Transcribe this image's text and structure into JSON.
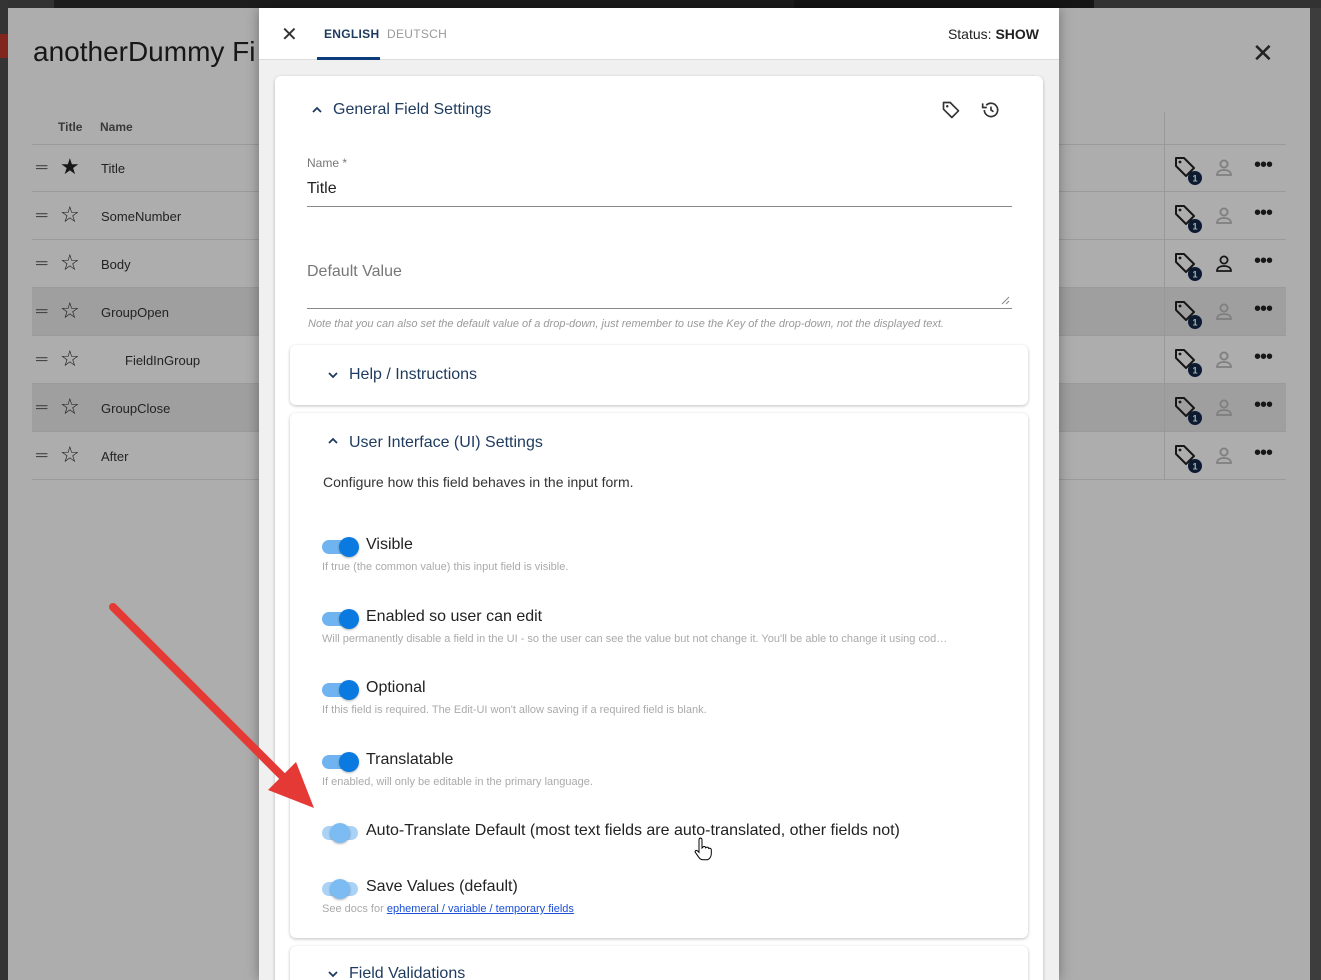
{
  "background": {
    "title": "anotherDummy Fi",
    "columns": {
      "title": "Title",
      "name": "Name"
    },
    "rows": [
      {
        "name": "Title",
        "starred": true,
        "badge": "1",
        "highlight": false,
        "indent": false,
        "person_active": false
      },
      {
        "name": "SomeNumber",
        "starred": false,
        "badge": "1",
        "highlight": false,
        "indent": false,
        "person_active": false
      },
      {
        "name": "Body",
        "starred": false,
        "badge": "1",
        "highlight": false,
        "indent": false,
        "person_active": true
      },
      {
        "name": "GroupOpen",
        "starred": false,
        "badge": "1",
        "highlight": true,
        "indent": false,
        "person_active": false
      },
      {
        "name": "FieldInGroup",
        "starred": false,
        "badge": "1",
        "highlight": false,
        "indent": true,
        "person_active": false
      },
      {
        "name": "GroupClose",
        "starred": false,
        "badge": "1",
        "highlight": true,
        "indent": false,
        "person_active": false
      },
      {
        "name": "After",
        "starred": false,
        "badge": "1",
        "highlight": false,
        "indent": false,
        "person_active": false
      }
    ]
  },
  "panel": {
    "tabs": [
      {
        "label": "ENGLISH",
        "active": true
      },
      {
        "label": "DEUTSCH",
        "active": false
      }
    ],
    "status_label": "Status:",
    "status_value": "SHOW",
    "general": {
      "title": "General Field Settings",
      "name_label": "Name *",
      "name_value": "Title",
      "default_label": "Default Value",
      "default_note": "Note that you can also set the default value of a drop-down, just remember to use the Key of the drop-down, not the displayed text."
    },
    "help": {
      "title": "Help / Instructions"
    },
    "ui": {
      "title": "User Interface (UI) Settings",
      "description": "Configure how this field behaves in the input form.",
      "toggles": [
        {
          "label": "Visible",
          "hint": "If true (the common value) this input field is visible.",
          "on": true
        },
        {
          "label": "Enabled so user can edit",
          "hint": "Will permanently disable a field in the UI - so the user can see the value but not change it. You'll be able to change it using cod…",
          "on": true
        },
        {
          "label": "Optional",
          "hint": "If this field is required. The Edit-UI won't allow saving if a required field is blank.",
          "on": true
        },
        {
          "label": "Translatable",
          "hint": "If enabled, will only be editable in the primary language.",
          "on": true
        },
        {
          "label": "Auto-Translate Default (most text fields are auto-translated, other fields not)",
          "hint": "",
          "on": false
        },
        {
          "label": "Save Values (default)",
          "hint": "See docs for",
          "link": "ephemeral / variable / temporary fields",
          "on": false
        }
      ]
    },
    "validations": {
      "title": "Field Validations"
    }
  },
  "colors": {
    "accent": "#0a7ae0",
    "heading": "#1e3a5f",
    "arrow": "#e53935"
  }
}
